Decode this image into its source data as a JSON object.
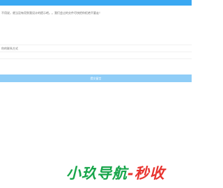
{
  "message": {
    "text": "不用说，就当没有用到我设计的提示吧。。我们会过的交件尽快把你拒绝不要走！"
  },
  "form": {
    "field_label": "你的联系方式"
  },
  "submit": {
    "label": "提交留言"
  },
  "watermark": {
    "part_a": "小玖导航",
    "part_b": "-秒收"
  },
  "colors": {
    "top_bar": "#3aa8f2",
    "button": "#8fcdf7",
    "watermark_green": "#17a54a",
    "watermark_red": "#e8342f"
  }
}
